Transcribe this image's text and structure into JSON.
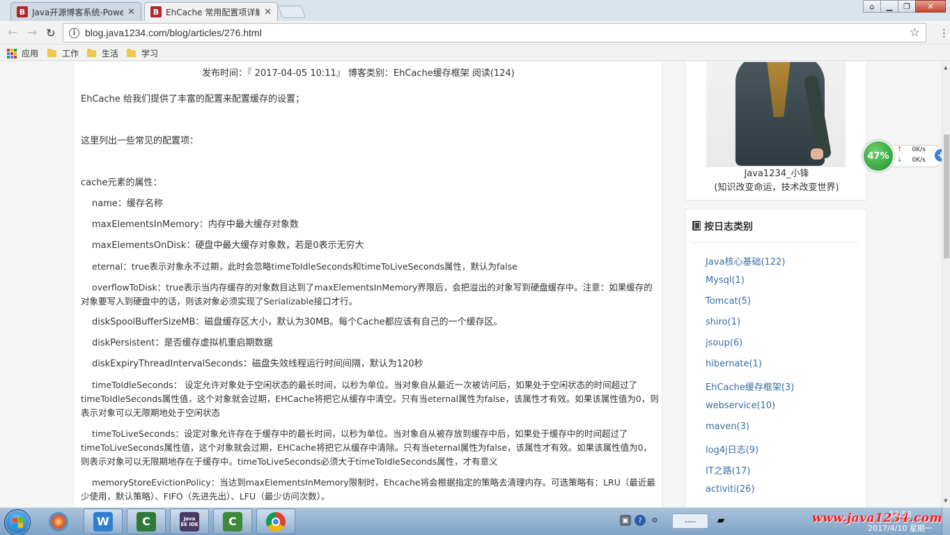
{
  "browser": {
    "tabs": [
      {
        "title": "Java开源博客系统-Powe",
        "favicon": "B",
        "active": false
      },
      {
        "title": "EhCache 常用配置项详解",
        "favicon": "B",
        "active": true
      }
    ],
    "url": "blog.java1234.com/blog/articles/276.html",
    "bookmarks": [
      {
        "label": "应用",
        "icon": "apps-grid-icon"
      },
      {
        "label": "工作",
        "icon": "folder-icon"
      },
      {
        "label": "生活",
        "icon": "folder-icon"
      },
      {
        "label": "学习",
        "icon": "folder-icon"
      }
    ]
  },
  "article": {
    "meta": "发布时间：『 2017-04-05 10:11』  博客类别：EhCache缓存框架  阅读(124)",
    "paragraphs": [
      {
        "text": "EhCache 给我们提供了丰富的配置来配置缓存的设置；",
        "indent": false
      },
      {
        "text": "这里列出一些常见的配置项：",
        "indent": false
      },
      {
        "text": "cache元素的属性：",
        "indent": false
      },
      {
        "text": "name：缓存名称",
        "indent": true
      },
      {
        "text": "maxElementsInMemory：内存中最大缓存对象数",
        "indent": true
      },
      {
        "text": "maxElementsOnDisk：硬盘中最大缓存对象数，若是0表示无穷大",
        "indent": true
      },
      {
        "text": "eternal：true表示对象永不过期，此时会忽略timeToIdleSeconds和timeToLiveSeconds属性，默认为false",
        "indent": true
      },
      {
        "text": "overflowToDisk：true表示当内存缓存的对象数目达到了maxElementsInMemory界限后，会把溢出的对象写到硬盘缓存中。注意：如果缓存的对象要写入到硬盘中的话，则该对象必须实现了Serializable接口才行。",
        "indent": true
      },
      {
        "text": "diskSpoolBufferSizeMB：磁盘缓存区大小，默认为30MB。每个Cache都应该有自己的一个缓存区。",
        "indent": true
      },
      {
        "text": "diskPersistent：是否缓存虚拟机重启期数据",
        "indent": true
      },
      {
        "text": "diskExpiryThreadIntervalSeconds：磁盘失效线程运行时间间隔，默认为120秒",
        "indent": true
      },
      {
        "text": "timeToIdleSeconds： 设定允许对象处于空闲状态的最长时间，以秒为单位。当对象自从最近一次被访问后，如果处于空闲状态的时间超过了timeToIdleSeconds属性值，这个对象就会过期，EHCache将把它从缓存中清空。只有当eternal属性为false，该属性才有效。如果该属性值为0，则表示对象可以无限期地处于空闲状态",
        "indent": true
      },
      {
        "text": "timeToLiveSeconds：设定对象允许存在于缓存中的最长时间，以秒为单位。当对象自从被存放到缓存中后，如果处于缓存中的时间超过了 timeToLiveSeconds属性值，这个对象就会过期，EHCache将把它从缓存中清除。只有当eternal属性为false，该属性才有效。如果该属性值为0，则表示对象可以无限期地存在于缓存中。timeToLiveSeconds必须大于timeToIdleSeconds属性，才有意义",
        "indent": true
      },
      {
        "text": "memoryStoreEvictionPolicy：当达到maxElementsInMemory限制时，Ehcache将会根据指定的策略去清理内存。可选策略有：LRU（最近最少使用，默认策略）、FIFO（先进先出）、LFU（最少访问次数）。",
        "indent": true
      }
    ]
  },
  "sidebar": {
    "profile": {
      "name": "Java1234_小锋",
      "motto": "(知识改变命运，技术改变世界)"
    },
    "categories": {
      "title": "按日志类别",
      "items": [
        "Java核心基础(122)",
        "Mysql(1)",
        "Tomcat(5)",
        "shiro(1)",
        "jsoup(6)",
        "hibernate(1)",
        "EhCache缓存框架(3)",
        "webservice(10)",
        "maven(3)",
        "log4j日志(9)",
        "IT之路(17)",
        "activiti(26)"
      ]
    }
  },
  "speed_widget": {
    "percent": "47%",
    "upload": "0K/s",
    "download": "0K/s"
  },
  "taskbar": {
    "apps": [
      {
        "name": "paint-app-icon",
        "color": "#e8a33a"
      },
      {
        "name": "wps-writer-icon",
        "label": "W",
        "color": "#2f7fd1"
      },
      {
        "name": "camtasia-icon",
        "label": "C",
        "color": "#2f7a3a"
      },
      {
        "name": "javaee-ide-icon",
        "label": "Java EE IDE",
        "color": "#4a3b63"
      },
      {
        "name": "camtasia-recorder-icon",
        "label": "C",
        "color": "#3f8a3a"
      },
      {
        "name": "chrome-icon",
        "color": "#dd4b39"
      }
    ],
    "ime": "----",
    "watermark": "www.java1234.com",
    "clock_time": "13:53",
    "clock_date": "2017/4/10 星期一"
  }
}
